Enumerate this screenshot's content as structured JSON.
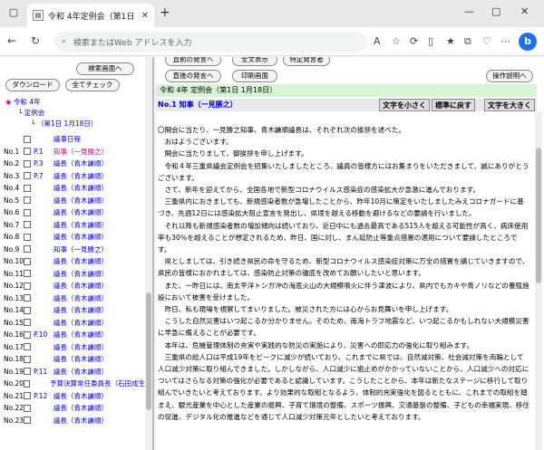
{
  "browser": {
    "tab_title": "令和 4年定例会（第1日 1月18日）",
    "address_placeholder": "検索またはWeb アドレスを入力"
  },
  "left_pane": {
    "buttons": {
      "search_screen": "検索画面へ",
      "download": "ダウンロード",
      "check_all": "全てチェック"
    },
    "tree": {
      "year": "令和 4年",
      "session": "定例会",
      "day": "（第1日 1月18日）"
    },
    "agenda": "議事日程",
    "rows": [
      {
        "no": "No.1",
        "page": "P.1",
        "speaker": "知事（一見勝之）",
        "hl": true
      },
      {
        "no": "No.2",
        "page": "P.3",
        "speaker": "議長（青木謙順）"
      },
      {
        "no": "No.3",
        "page": "P.7",
        "speaker": "議長（青木謙順）"
      },
      {
        "no": "No.4",
        "page": "",
        "speaker": "議長（青木謙順）"
      },
      {
        "no": "No.5",
        "page": "",
        "speaker": "議長（青木謙順）"
      },
      {
        "no": "No.6",
        "page": "",
        "speaker": "議長（青木謙順）"
      },
      {
        "no": "No.7",
        "page": "",
        "speaker": "議長（青木謙順）"
      },
      {
        "no": "No.8",
        "page": "",
        "speaker": "議長（青木謙順）"
      },
      {
        "no": "No.9",
        "page": "",
        "speaker": "知事（一見勝之）"
      },
      {
        "no": "No.10",
        "page": "",
        "speaker": "議長（青木謙順）"
      },
      {
        "no": "No.11",
        "page": "",
        "speaker": "議長（青木謙順）"
      },
      {
        "no": "No.12",
        "page": "",
        "speaker": "議長（青木謙順）"
      },
      {
        "no": "No.13",
        "page": "",
        "speaker": "議長（青木謙順）"
      },
      {
        "no": "No.14",
        "page": "",
        "speaker": "議長（青木謙順）"
      },
      {
        "no": "No.15",
        "page": "",
        "speaker": "議長（青木謙順）"
      },
      {
        "no": "No.16",
        "page": "P.10",
        "speaker": "議長（青木謙順）"
      },
      {
        "no": "No.17",
        "page": "",
        "speaker": "議長（青木謙順）"
      },
      {
        "no": "No.18",
        "page": "",
        "speaker": "議長（青木謙順）"
      },
      {
        "no": "No.19",
        "page": "P.11",
        "speaker": "議長（青木謙順）"
      },
      {
        "no": "No.20",
        "page": "",
        "speaker": "予算決算常任委員長（石田成生"
      },
      {
        "no": "No.21",
        "page": "P.12",
        "speaker": "議長（青木謙順）"
      },
      {
        "no": "No.22",
        "page": "",
        "speaker": "議長（青木謙順）"
      },
      {
        "no": "No.23",
        "page": "",
        "speaker": "議長（青木謙順）"
      }
    ]
  },
  "right_pane": {
    "buttons": {
      "prev_speaker": "直前の発言へ",
      "show_all": "全文表示",
      "specific_speaker": "特定発言者",
      "next_speaker": "直後の発言へ",
      "print_screen": "印刷画面",
      "help": "操作説明へ"
    },
    "header": "令和 4年 定例会（第1日 1月18日）",
    "speaker_line": "No.1 知事（一見勝之）",
    "font_buttons": {
      "small": "文字を小さく",
      "standard": "標準に戻す",
      "large": "文字を大きく"
    },
    "paragraphs": [
      "〇開会に当たり、一見勝之知事、青木謙順議長は、それぞれ次の挨拶を述べた。",
      "　おはようございます。",
      "　開会に当たりまして、御挨拶を申し上げます。",
      "　令和４年三重県議会定例会を招集いたしましたところ、議員の皆様方にはお集まりをいただきまして、誠にありがとうございます。",
      "　さて、新年を迎えてから、全国各地で新型コロナウイルス感染症の感染拡大が急激に進んでおります。",
      "　三重県内におきましても、新規感染者数が急増したことから、昨年10月に策定をいたしましたみえコロナガードに基づき、先週12日には感染拡大阻止宣言を発出し、県境を越える移動を避けるなどの要請を行いました。",
      "　それ以降も新規感染者数の増加傾向は続いており、近日中にも過去最高である515人を超える可能性が高く、病床使用率も30％を超えることが想定されるため、昨日、国に対し、まん延防止等重点措置の適用について要請したところです。",
      "　県としましては、引き続き県民の命を守るため、新型コロナウイルス感染症対策に万全の措置を講じていきますので、県民の皆様におかれましては、感染防止対策の徹底を改めてお願いしたいと思います。",
      "　また、一昨日には、南太平洋トンガ沖の海底火山の大規模噴火に伴う津波により、県内でもカキや青ノリなどの養殖施設において被害を受けました。",
      "　昨日、私も現場を視察してまいりました。被災された方には心からお見舞いを申し上げます。",
      "　こうした自然災害はいつ起こるか分かりません。そのため、南海トラフ地震など、いつ起こるかもしれない大規模災害に早急に備えることが必要です。",
      "　本年は、危機管理体制の充実や実践的な防災の実施により、災害への即応力の強化に取り組みます。",
      "　三重県の総人口は平成19年をピークに減少が続いており、これまでに県では、自然減対策、社会減対策を両輪として人口減少対策に取り組んできました。しかしながら、人口減少に歯止めがかかっていないことから、人口減少への対応についてはさらなる対策の強化が必要であると認識しています。こうしたことから、本年は新たなステージに移行して取り組んでいきたいと考えております。より効果的な取組となるよう、体制的充実強化を図るとともに、これまでの取組を踏まえ、観光産業を中心とした産業の振興、子育て環境の整備、スポーツ振興、交通基盤の整備、子どもの幸福実現、移住の促進、デジタル化の推進などを通じて人口減少対策元年としたいと考えております。"
    ]
  }
}
